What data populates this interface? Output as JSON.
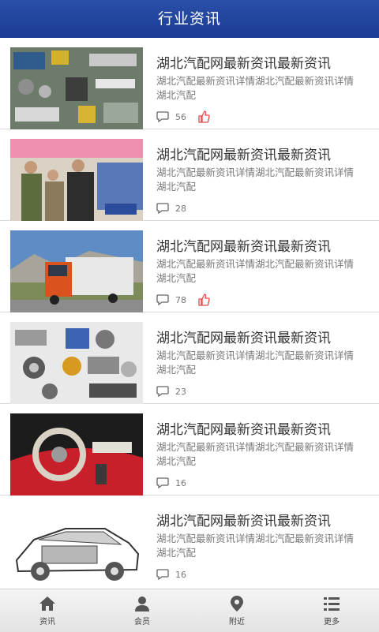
{
  "header": {
    "title": "行业资讯"
  },
  "articles": [
    {
      "title": "湖北汽配网最新资讯最新资讯",
      "desc": "湖北汽配最新资讯详情湖北汽配最新资讯详情湖北汽配",
      "comments": "56",
      "liked": true,
      "image": "circuit-board-photo"
    },
    {
      "title": "湖北汽配网最新资讯最新资讯",
      "desc": "湖北汽配最新资讯详情湖北汽配最新资讯详情湖北汽配",
      "comments": "28",
      "liked": false,
      "image": "shop-people-photo"
    },
    {
      "title": "湖北汽配网最新资讯最新资讯",
      "desc": "湖北汽配最新资讯详情湖北汽配最新资讯详情湖北汽配",
      "comments": "78",
      "liked": true,
      "image": "truck-photo"
    },
    {
      "title": "湖北汽配网最新资讯最新资讯",
      "desc": "湖北汽配最新资讯详情湖北汽配最新资讯详情湖北汽配",
      "comments": "23",
      "liked": false,
      "image": "auto-parts-photo"
    },
    {
      "title": "湖北汽配网最新资讯最新资讯",
      "desc": "湖北汽配最新资讯详情湖北汽配最新资讯详情湖北汽配",
      "comments": "16",
      "liked": false,
      "image": "car-interior-photo"
    },
    {
      "title": "湖北汽配网最新资讯最新资讯",
      "desc": "湖北汽配最新资讯详情湖北汽配最新资讯详情湖北汽配",
      "comments": "16",
      "liked": false,
      "image": "car-cutaway-photo"
    }
  ],
  "tabs": [
    {
      "label": "资讯",
      "icon": "home-icon"
    },
    {
      "label": "会员",
      "icon": "user-icon"
    },
    {
      "label": "附近",
      "icon": "location-pin-icon"
    },
    {
      "label": "更多",
      "icon": "menu-list-icon"
    }
  ],
  "colors": {
    "header": "#1f409a",
    "like": "#e04a4a"
  }
}
